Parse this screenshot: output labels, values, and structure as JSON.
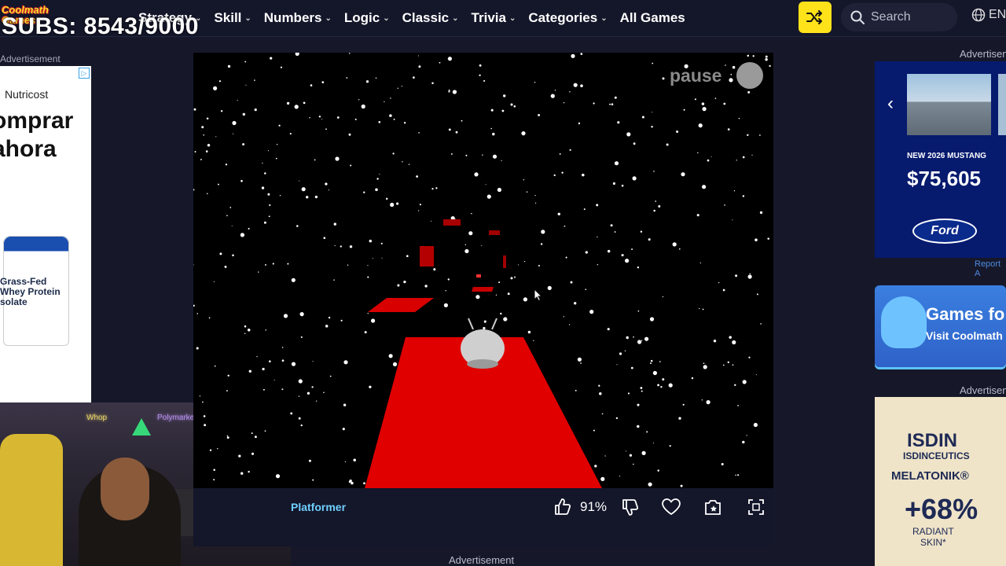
{
  "header": {
    "logo_text": "Coolmath Games",
    "nav": [
      {
        "label": "Strategy",
        "dropdown": true
      },
      {
        "label": "Skill",
        "dropdown": true
      },
      {
        "label": "Numbers",
        "dropdown": true
      },
      {
        "label": "Logic",
        "dropdown": true
      },
      {
        "label": "Classic",
        "dropdown": true
      },
      {
        "label": "Trivia",
        "dropdown": true
      },
      {
        "label": "Categories",
        "dropdown": true
      },
      {
        "label": "All Games",
        "dropdown": false
      }
    ],
    "search_placeholder": "Search",
    "language": "EN",
    "accent_color": "#ffe21a"
  },
  "overlay": {
    "subs_counter": "SUBS: 8543/9000"
  },
  "left_ad": {
    "label": "Advertisement",
    "brand": "Nutricost",
    "cta_line1": "omprar",
    "cta_line2": "ahora",
    "product_line1": "Grass-Fed",
    "product_line2": "Whey Protein",
    "product_line3": "solate"
  },
  "webcam": {
    "sign1": "Whop",
    "sign2": "Polymarket"
  },
  "game": {
    "pause_label": "pause",
    "genre_tag": "Platformer",
    "like_percent": "91%",
    "colors": {
      "background": "#000000",
      "platform": "#e00000",
      "player": "#c8c8c8"
    }
  },
  "bottom_ad_label": "Advertisement",
  "right_ads": {
    "label_top": "Advertisem",
    "car_ad": {
      "model": "NEW 2026 MUSTANG",
      "price": "$75,605",
      "brand": "Ford"
    },
    "report_text": "Report A",
    "promo": {
      "title": "Games fo",
      "subtitle": "Visit Coolmath"
    },
    "label_second": "Advertisem",
    "isdin": {
      "brand": "ISDIN",
      "sub_brand": "ISDINCEUTICS",
      "product": "MELATONIK®",
      "stat": "+68%",
      "stat_line1": "RADIANT",
      "stat_line2": "SKIN*"
    }
  }
}
